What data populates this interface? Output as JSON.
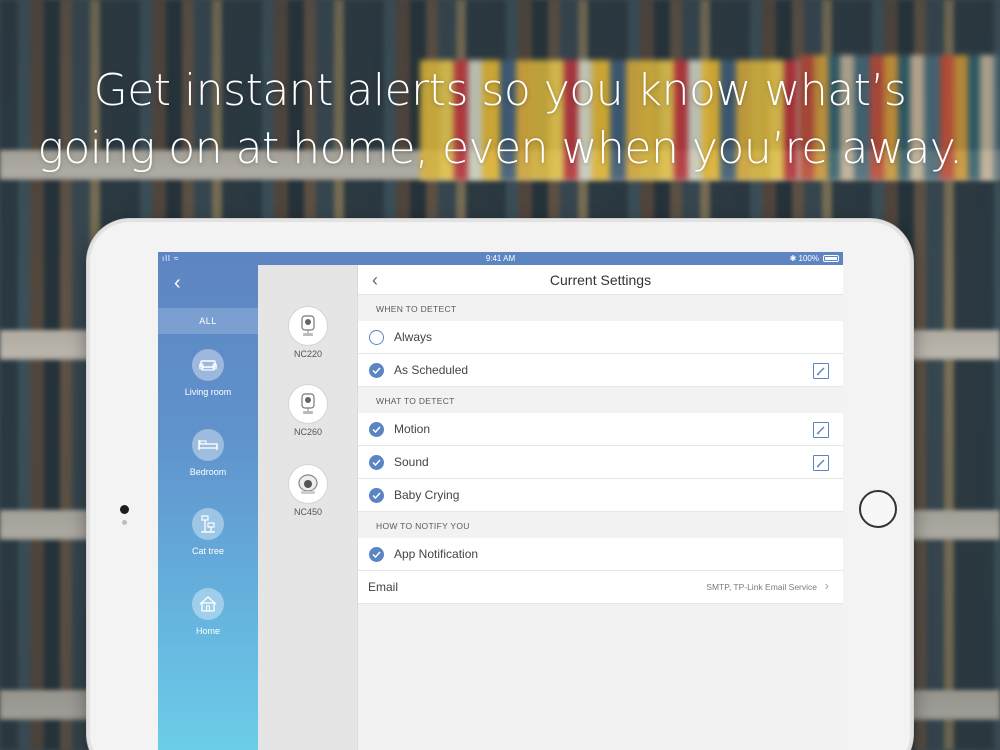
{
  "headline": {
    "line1": "Get instant alerts so you know what’s",
    "line2": "going on at home, even when you’re away."
  },
  "statusbar": {
    "time": "9:41 AM",
    "battery": "100%"
  },
  "locations": {
    "all_tab": "ALL",
    "items": [
      {
        "label": "Living room",
        "icon": "sofa-icon"
      },
      {
        "label": "Bedroom",
        "icon": "bed-icon"
      },
      {
        "label": "Cat tree",
        "icon": "cat-tree-icon"
      },
      {
        "label": "Home",
        "icon": "house-icon"
      }
    ]
  },
  "cameras": [
    {
      "label": "NC220",
      "icon": "camera-icon"
    },
    {
      "label": "NC260",
      "icon": "camera-icon"
    },
    {
      "label": "NC450",
      "icon": "pan-tilt-camera-icon"
    }
  ],
  "settings": {
    "title": "Current Settings",
    "when_header": "WHEN TO DETECT",
    "when_items": [
      {
        "label": "Always",
        "checked": false,
        "editable": false
      },
      {
        "label": "As Scheduled",
        "checked": true,
        "editable": true
      }
    ],
    "what_header": "WHAT TO DETECT",
    "what_items": [
      {
        "label": "Motion",
        "checked": true,
        "editable": true
      },
      {
        "label": "Sound",
        "checked": true,
        "editable": true
      },
      {
        "label": "Baby Crying",
        "checked": true,
        "editable": false
      }
    ],
    "notify_header": "HOW TO NOTIFY YOU",
    "notify_items": [
      {
        "label": "App Notification",
        "checked": true
      }
    ],
    "email": {
      "label": "Email",
      "value": "SMTP, TP-Link Email Service"
    }
  },
  "colors": {
    "accent": "#5b84c4",
    "statusbar": "#5d85c2"
  }
}
